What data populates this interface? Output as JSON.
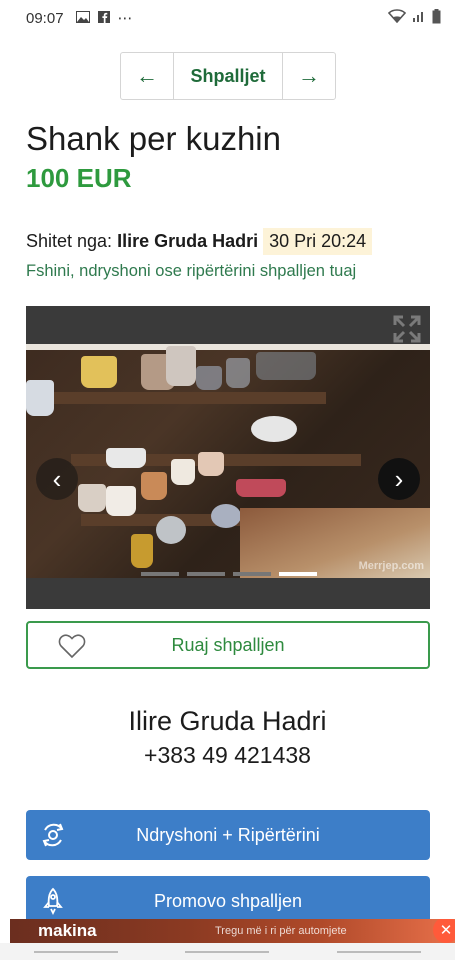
{
  "status_bar": {
    "time": "09:07",
    "more": "⋯"
  },
  "pager": {
    "prev_icon": "←",
    "label": "Shpalljet",
    "next_icon": "→"
  },
  "listing": {
    "title": "Shank per kuzhin",
    "price": "100 EUR",
    "seller_prefix": "Shitet nga:",
    "seller_name": "Ilire Gruda Hadri",
    "date": "30 Pri 20:24",
    "edit_link": "Fshini, ndryshoni ose ripërtërini shpalljen tuaj"
  },
  "gallery": {
    "watermark": "Merrjep.com",
    "prev_icon": "‹",
    "next_icon": "›",
    "slide_count": 4,
    "active_slide": 4
  },
  "save_button": {
    "label": "Ruaj shpalljen"
  },
  "contact": {
    "name": "Ilire Gruda Hadri",
    "phone": "+383 49 421438"
  },
  "actions": {
    "renew_label": "Ndryshoni + Ripërtërini",
    "promote_label": "Promovo shpalljen"
  },
  "ad": {
    "logo": "makina",
    "text": "Tregu më i ri për automjete",
    "close": "✕"
  },
  "colors": {
    "brand_green": "#2e9a3e",
    "link_green": "#2f7a4e",
    "button_blue": "#3d7ec8",
    "date_highlight": "#fdf3d8"
  }
}
